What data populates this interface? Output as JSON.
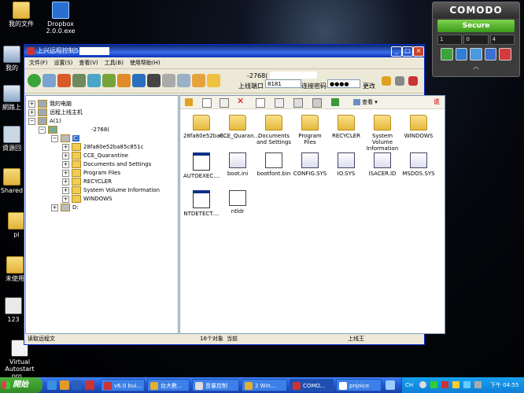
{
  "desktop": {
    "icons": [
      {
        "label": "我的文件"
      },
      {
        "label": "Dropbox 2.0.0.exe"
      },
      {
        "label": "我的"
      },
      {
        "label": "網路上"
      },
      {
        "label": "資源回"
      },
      {
        "label": "Shared"
      },
      {
        "label": "pi"
      },
      {
        "label": "未使用"
      },
      {
        "label": "123"
      },
      {
        "label": "Virtual Autostart pro..."
      }
    ]
  },
  "comodo": {
    "brand": "COMODO",
    "status": "Secure",
    "counts": [
      "1",
      "0",
      "4"
    ]
  },
  "window": {
    "title": "上兴远程控制5.1",
    "menu": [
      "文件(F)",
      "设置(S)",
      "查看(V)",
      "工具(B)",
      "使用帮助(H)"
    ],
    "toolbar": {
      "connection_id": "-2768(",
      "port_label": "上线端口",
      "port_value": "8181",
      "password_label": "连接密码",
      "password_value": "●●●●",
      "change_label": "更改"
    },
    "tree": {
      "nodes": [
        {
          "label": "我的电脑"
        },
        {
          "label": "远程上线主机"
        },
        {
          "label": "A(1)"
        },
        {
          "label": "-2768("
        },
        {
          "label": "C:"
        },
        {
          "label": "28fa80e52ba85c851c"
        },
        {
          "label": "CCE_Quarantine"
        },
        {
          "label": "Documents and Settings"
        },
        {
          "label": "Program Files"
        },
        {
          "label": "RECYCLER"
        },
        {
          "label": "System Volume Information"
        },
        {
          "label": "WINDOWS"
        },
        {
          "label": "D:"
        }
      ]
    },
    "file_toolbar": {
      "view_label": "查看",
      "right_label": "谁"
    },
    "files": [
      {
        "name": "28fa80e52ba8...",
        "kind": "folder"
      },
      {
        "name": "CCE_Quaran...",
        "kind": "folder"
      },
      {
        "name": "Documents and Settings",
        "kind": "folder"
      },
      {
        "name": "Program Files",
        "kind": "folder"
      },
      {
        "name": "RECYCLER",
        "kind": "folder"
      },
      {
        "name": "System Volume Information",
        "kind": "folder"
      },
      {
        "name": "WINDOWS",
        "kind": "folder"
      },
      {
        "name": "AUTOEXEC....",
        "kind": "exe"
      },
      {
        "name": "boot.ini",
        "kind": "sys"
      },
      {
        "name": "bootfont.bin",
        "kind": "doc"
      },
      {
        "name": "CONFIG.SYS",
        "kind": "sys"
      },
      {
        "name": "IO.SYS",
        "kind": "sys"
      },
      {
        "name": "ISACER.ID",
        "kind": "sys"
      },
      {
        "name": "MSDOS.SYS",
        "kind": "sys"
      },
      {
        "name": "NTDETECT....",
        "kind": "exe"
      },
      {
        "name": "ntldr",
        "kind": "doc"
      }
    ],
    "status": {
      "left": "读取远程文",
      "count": "16个对象",
      "selected": "当前",
      "right": "上线王"
    }
  },
  "taskbar": {
    "start": "開始",
    "buttons": [
      {
        "label": "v6.0 bui..."
      },
      {
        "label": "台大數..."
      },
      {
        "label": "音量控制"
      },
      {
        "label": "2 Win..."
      },
      {
        "label": "COMO..."
      },
      {
        "label": "pnjoice"
      }
    ],
    "lang": "CH",
    "clock": "下午 04:55"
  },
  "colors": {
    "titlebar": "#0a246a",
    "comodo_secure": "#3a9a1a",
    "taskbar": "#245ddb",
    "start": "#2e8b21"
  }
}
